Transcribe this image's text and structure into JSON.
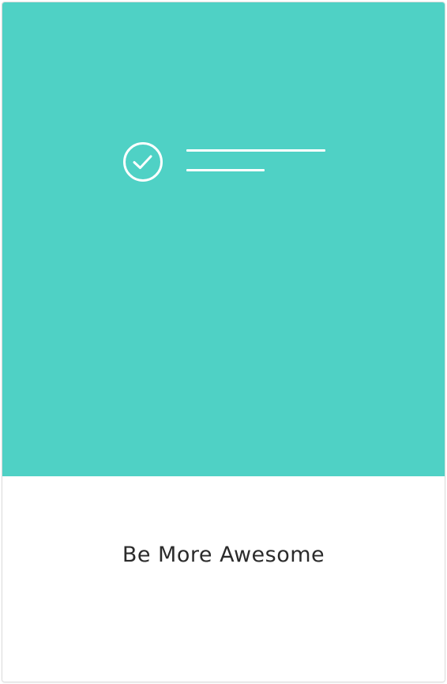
{
  "card": {
    "title": "Be More Awesome"
  },
  "colors": {
    "hero_background": "#4fd1c5",
    "icon_stroke": "#ffffff",
    "caption_text": "#2b2b2b"
  },
  "icons": {
    "checkmark": "check-circle-icon"
  }
}
